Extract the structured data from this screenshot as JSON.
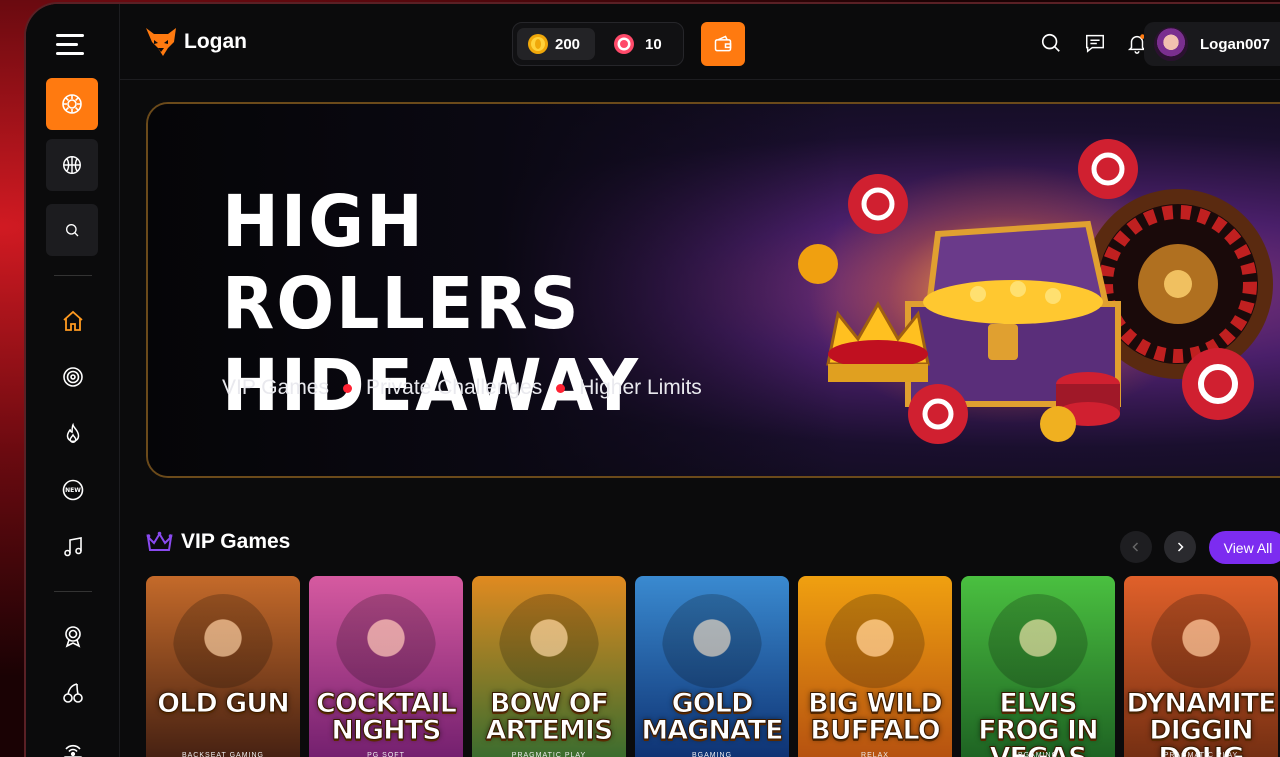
{
  "brand": {
    "name": "Logan",
    "accent": "#ff7a10"
  },
  "balances": {
    "coins": "200",
    "gems": "10"
  },
  "user": {
    "name": "Logan007"
  },
  "banner": {
    "title_line1": "HIGH ROLLERS",
    "title_line2": "HIDEAWAY",
    "tags": [
      "VIP Games",
      "Private Challenges",
      "Higher Limits"
    ]
  },
  "section": {
    "title": "VIP Games",
    "view_all": "View All"
  },
  "games": [
    {
      "title": "OLD GUN",
      "provider": "BACKSEAT GAMING",
      "bg": "#c46a2a",
      "bg2": "#3a1a10"
    },
    {
      "title": "COCKTAIL NIGHTS",
      "provider": "PG SOFT",
      "bg": "#d65aa0",
      "bg2": "#6a1a6a"
    },
    {
      "title": "BOW OF ARTEMIS",
      "provider": "PRAGMATIC PLAY",
      "bg": "#e08a20",
      "bg2": "#2a6a30"
    },
    {
      "title": "GOLD MAGNATE",
      "provider": "BGAMING",
      "bg": "#3a8ad0",
      "bg2": "#0a2a6a"
    },
    {
      "title": "BIG WILD BUFFALO",
      "provider": "RELAX",
      "bg": "#f0a010",
      "bg2": "#b04a10"
    },
    {
      "title": "ELVIS FROG IN VEGAS",
      "provider": "BGAMING",
      "bg": "#4ac040",
      "bg2": "#1a5a20"
    },
    {
      "title": "DYNAMITE DIGGIN DOUG",
      "provider": "PRAGMATIC PLAY",
      "bg": "#e0602a",
      "bg2": "#6a2a10"
    }
  ]
}
